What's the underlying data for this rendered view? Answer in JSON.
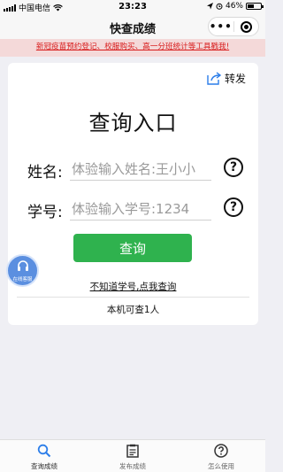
{
  "status_bar": {
    "carrier": "中国电信",
    "time": "23:23",
    "battery": "46%"
  },
  "nav": {
    "title": "快查成绩",
    "more_label": "•••"
  },
  "notice": {
    "text": "新冠疫苗预约登记、校服购买、高一分班统计等工具戳我!"
  },
  "card": {
    "share_label": "转发",
    "title": "查询入口",
    "name_field": {
      "label": "姓名:",
      "placeholder": "体验输入姓名:王小小",
      "value": ""
    },
    "id_field": {
      "label": "学号:",
      "placeholder": "体验输入学号:1234",
      "value": ""
    },
    "help_mark": "?",
    "query_button": "查询",
    "forgot_link": "不知道学号,点我查询",
    "limit_text": "本机可查1人"
  },
  "service": {
    "label": "在线客服"
  },
  "tabs": [
    {
      "label": "查询成绩",
      "icon": "search-icon",
      "active": true
    },
    {
      "label": "发布成绩",
      "icon": "document-icon",
      "active": false
    },
    {
      "label": "怎么使用",
      "icon": "help-circle-icon",
      "active": false
    }
  ],
  "colors": {
    "accent_green": "#2fb24e",
    "notice_red": "#d81b1b",
    "notice_bg": "#f4d9d9",
    "active_tab_blue": "#2b7de9"
  }
}
